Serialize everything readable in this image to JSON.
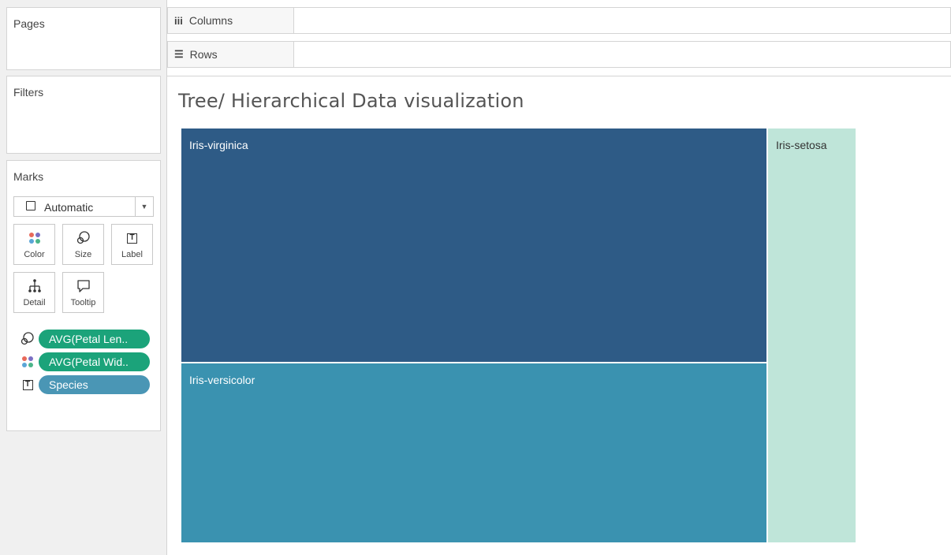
{
  "panels": {
    "pages": "Pages",
    "filters": "Filters",
    "marks": "Marks",
    "columns": "Columns",
    "rows": "Rows"
  },
  "marks_card": {
    "mark_type": "Automatic",
    "buttons": [
      {
        "label": "Color",
        "icon": "color-dots-icon"
      },
      {
        "label": "Size",
        "icon": "size-icon"
      },
      {
        "label": "Label",
        "icon": "label-text-icon"
      },
      {
        "label": "Detail",
        "icon": "detail-hierarchy-icon"
      },
      {
        "label": "Tooltip",
        "icon": "tooltip-bubble-icon"
      }
    ],
    "pills": [
      {
        "label": "AVG(Petal Len..",
        "encoding": "size",
        "type": "measure"
      },
      {
        "label": "AVG(Petal Wid..",
        "encoding": "color",
        "type": "measure"
      },
      {
        "label": "Species",
        "encoding": "label",
        "type": "dimension"
      }
    ]
  },
  "colors": {
    "measure_pill": "#1ba37a",
    "dimension_pill": "#4a96b5",
    "dots": [
      "#e8695a",
      "#7b6fc4",
      "#5aa5d6",
      "#4bb58a"
    ]
  },
  "chart_data": {
    "type": "treemap",
    "title": "Tree/ Hierarchical Data visualization",
    "size_measure": "AVG(Petal Length)",
    "color_measure": "AVG(Petal Width)",
    "label_field": "Species",
    "nodes": [
      {
        "name": "Iris-virginica",
        "size": 5.55,
        "color": "#2e5b86",
        "label_color": "#ffffff"
      },
      {
        "name": "Iris-versicolor",
        "size": 4.26,
        "color": "#3a92b0",
        "label_color": "#ffffff"
      },
      {
        "name": "Iris-setosa",
        "size": 1.46,
        "color": "#bfe5d9",
        "label_color": "#333333"
      }
    ]
  }
}
